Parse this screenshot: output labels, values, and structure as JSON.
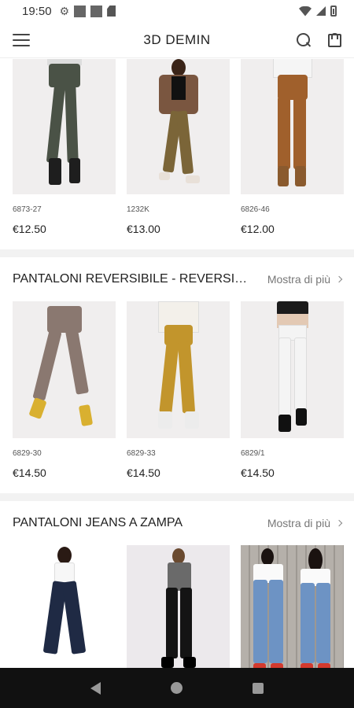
{
  "status_bar": {
    "time": "19:50"
  },
  "app_bar": {
    "title": "3D DEMIN"
  },
  "sections": [
    {
      "title": "",
      "see_more": "",
      "products": [
        {
          "code": "6873-27",
          "price": "€12.50"
        },
        {
          "code": "1232K",
          "price": "€13.00"
        },
        {
          "code": "6826-46",
          "price": "€12.00"
        }
      ]
    },
    {
      "title": "PANTALONI REVERSIBILE - REVERSIBL...",
      "see_more": "Mostra di più",
      "products": [
        {
          "code": "6829-30",
          "price": "€14.50"
        },
        {
          "code": "6829-33",
          "price": "€14.50"
        },
        {
          "code": "6829/1",
          "price": "€14.50"
        }
      ]
    },
    {
      "title": "PANTALONI JEANS A ZAMPA",
      "see_more": "Mostra di più",
      "products": [
        {
          "code": "",
          "price": ""
        },
        {
          "code": "",
          "price": ""
        },
        {
          "code": "",
          "price": ""
        }
      ]
    }
  ],
  "colors": {
    "accent": "#222222",
    "background": "#f2f2f2",
    "nav_bar": "#111111"
  }
}
